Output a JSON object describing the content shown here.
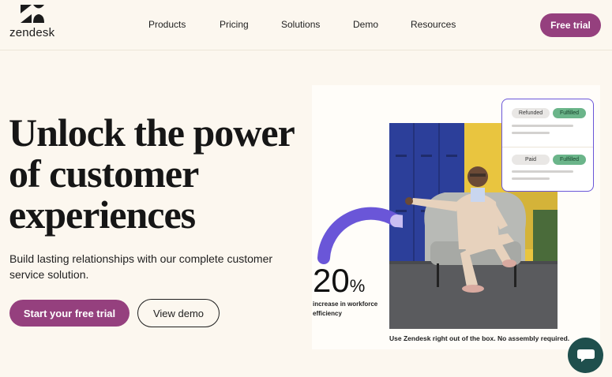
{
  "brand": {
    "logo_text": "zendesk"
  },
  "nav": {
    "items": [
      "Products",
      "Pricing",
      "Solutions",
      "Demo",
      "Resources"
    ],
    "cta": "Free trial"
  },
  "hero": {
    "headline_line1": "Unlock the power",
    "headline_line2": "of customer",
    "headline_line3": "experiences",
    "subtitle": "Build lasting relationships with our complete customer service solution.",
    "primary_cta": "Start your free trial",
    "secondary_cta": "View demo"
  },
  "visual": {
    "stat_value": "20",
    "stat_unit": "%",
    "stat_label": "increase in workforce efficiency",
    "stat_progress": 0.2,
    "caption": "Use Zendesk right out of the box. No assembly required.",
    "card": {
      "row1_status": "Refunded",
      "row1_badge": "Fulfilled",
      "row2_status": "Paid",
      "row2_badge": "Fulfilled"
    }
  },
  "colors": {
    "primary": "#95407e",
    "accent_purple": "#6a56d8",
    "chat_bg": "#1f4f4d",
    "fulfilled_green": "#6bb58a"
  },
  "icons": {
    "logo": "zendesk-logo-icon",
    "chat": "chat-bubble-icon"
  }
}
